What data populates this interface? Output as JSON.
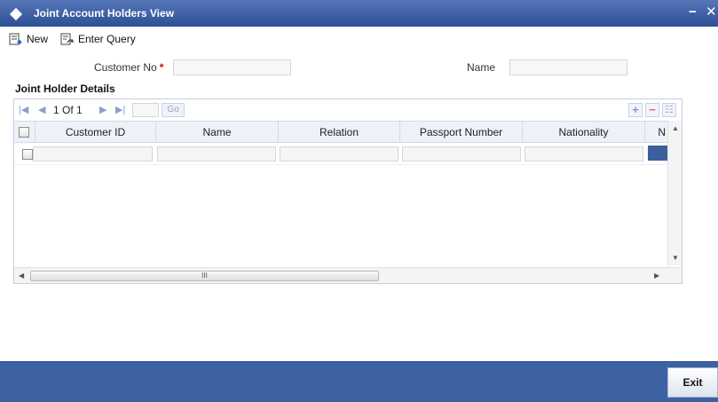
{
  "window": {
    "title": "Joint Account Holders View",
    "minimize": "−",
    "close": "✕"
  },
  "toolbar": {
    "new_label": "New",
    "enter_query_label": "Enter Query"
  },
  "form": {
    "customer_no_label": "Customer No",
    "required_mark": "*",
    "customer_no_value": "",
    "name_label": "Name",
    "name_value": ""
  },
  "section": {
    "title": "Joint Holder Details"
  },
  "pager": {
    "page_text": "1 Of 1",
    "go_label": "Go",
    "add_symbol": "+",
    "remove_symbol": "−",
    "view_symbol": "☷"
  },
  "grid": {
    "columns": [
      "Customer ID",
      "Name",
      "Relation",
      "Passport Number",
      "Nationality",
      "N"
    ],
    "rows": [
      {
        "customer_id": "",
        "name": "",
        "relation": "",
        "passport_number": "",
        "nationality": ""
      }
    ],
    "scroll_grip": "III"
  },
  "footer": {
    "exit_label": "Exit"
  },
  "colors": {
    "title_bar": "#2d4f95",
    "footer": "#3d62a3",
    "required": "#dd0000",
    "selected_cell": "#3c5f9d"
  },
  "icons": [
    "diamond-icon",
    "new-icon",
    "enter-query-icon",
    "first-page-icon",
    "prev-page-icon",
    "next-page-icon",
    "last-page-icon",
    "add-row-icon",
    "remove-row-icon",
    "view-rows-icon"
  ]
}
